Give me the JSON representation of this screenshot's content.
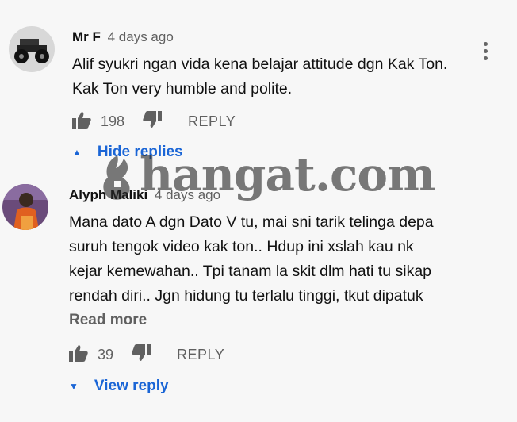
{
  "comment1": {
    "author": "Mr F",
    "time": "4 days ago",
    "text_line1": "Alif syukri ngan vida kena belajar attitude dgn Kak Ton.",
    "text_line2": "Kak Ton very humble and polite.",
    "likes": "198",
    "reply_label": "REPLY",
    "avatar_icon": "monster-truck-avatar"
  },
  "toggle_hide": {
    "label": "Hide replies",
    "icon": "caret-up-icon"
  },
  "comment2": {
    "author": "Alyph Maliki",
    "time": "4 days ago",
    "text_lines": [
      "Mana dato A dgn Dato V tu, mai sni tarik telinga depa",
      "suruh tengok video kak ton.. Hdup ini xslah kau nk",
      "kejar kemewahan.. Tpi tanam la skit dlm hati tu sikap",
      "rendah diri.. Jgn hidung tu terlalu tinggi, tkut dipatuk"
    ],
    "read_more": "Read more",
    "likes": "39",
    "reply_label": "REPLY",
    "avatar_icon": "person-photo-avatar"
  },
  "toggle_view": {
    "label": "View reply",
    "icon": "caret-down-icon"
  },
  "watermark": {
    "text": "hangat.com"
  },
  "colors": {
    "link": "#1a65d6",
    "muted": "#606060",
    "background": "#f7f7f7"
  }
}
